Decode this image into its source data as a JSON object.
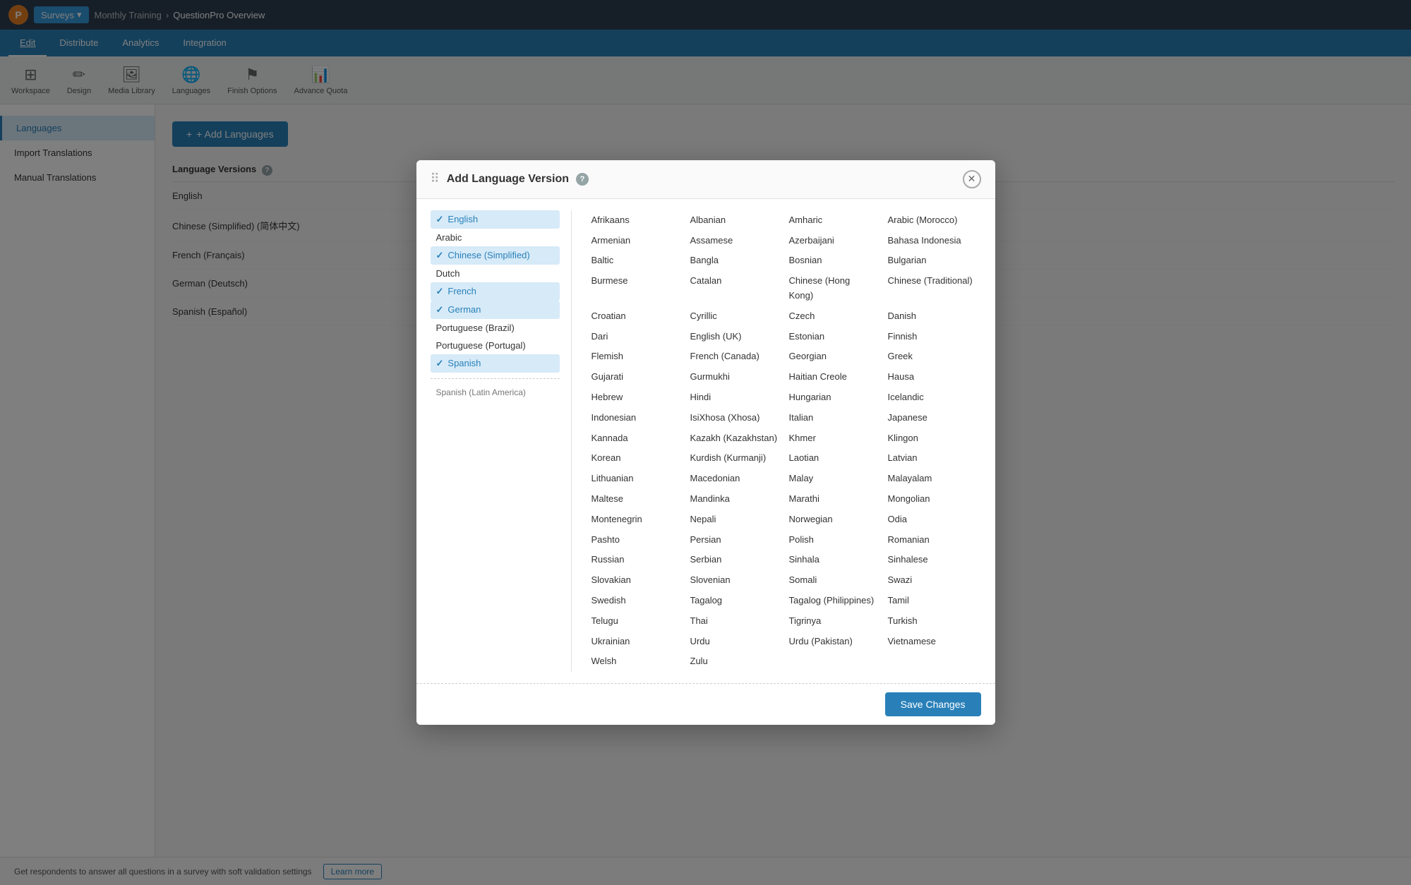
{
  "topnav": {
    "logo": "P",
    "surveys_label": "Surveys",
    "breadcrumb_training": "Monthly Training",
    "breadcrumb_sep": "›",
    "breadcrumb_current": "QuestionPro Overview"
  },
  "secondnav": {
    "tabs": [
      "Edit",
      "Distribute",
      "Analytics",
      "Integration"
    ]
  },
  "toolbar": {
    "items": [
      {
        "icon": "⊞",
        "label": "Workspace"
      },
      {
        "icon": "✏",
        "label": "Design"
      },
      {
        "icon": "🖼",
        "label": "Media Library"
      },
      {
        "icon": "🌐",
        "label": "Languages"
      },
      {
        "icon": "⚑",
        "label": "Finish Options"
      },
      {
        "icon": "📊",
        "label": "Advance Quota"
      }
    ]
  },
  "sidebar": {
    "items": [
      "Languages",
      "Import Translations",
      "Manual Translations"
    ]
  },
  "content": {
    "add_languages_label": "+ Add Languages",
    "lang_versions_header": "Language Versions",
    "help_icon": "?",
    "language_versions": [
      "English",
      "Chinese (Simplified) (简体中文)",
      "French (Français)",
      "German (Deutsch)",
      "Spanish (Español)"
    ]
  },
  "modal": {
    "title": "Add Language Version",
    "help": "?",
    "drag_handle": "⠿",
    "close": "✕",
    "checked_languages": [
      {
        "label": "English",
        "checked": true
      },
      {
        "label": "Arabic",
        "checked": false
      },
      {
        "label": "Chinese (Simplified)",
        "checked": true
      },
      {
        "label": "Dutch",
        "checked": false
      },
      {
        "label": "French",
        "checked": true
      },
      {
        "label": "German",
        "checked": true
      },
      {
        "label": "Portuguese (Brazil)",
        "checked": false
      },
      {
        "label": "Portuguese (Portugal)",
        "checked": false
      },
      {
        "label": "Spanish",
        "checked": true
      }
    ],
    "other_section_label": "Spanish (Latin America)",
    "other_languages": [
      "Afrikaans",
      "Albanian",
      "Amharic",
      "Arabic (Morocco)",
      "Armenian",
      "Assamese",
      "Azerbaijani",
      "Bahasa Indonesia",
      "Baltic",
      "Bangla",
      "Bosnian",
      "Bulgarian",
      "Burmese",
      "Catalan",
      "Chinese (Hong Kong)",
      "Chinese (Traditional)",
      "Croatian",
      "Cyrillic",
      "Czech",
      "Danish",
      "Dari",
      "English (UK)",
      "Estonian",
      "Finnish",
      "Flemish",
      "French (Canada)",
      "Georgian",
      "Greek",
      "Gujarati",
      "Gurmukhi",
      "Haitian Creole",
      "Hausa",
      "Hebrew",
      "Hindi",
      "Hungarian",
      "Icelandic",
      "Indonesian",
      "IsiXhosa (Xhosa)",
      "Italian",
      "Japanese",
      "Kannada",
      "Kazakh (Kazakhstan)",
      "Khmer",
      "Klingon",
      "Korean",
      "Kurdish (Kurmanji)",
      "Laotian",
      "Latvian",
      "Lithuanian",
      "Macedonian",
      "Malay",
      "Malayalam",
      "Maltese",
      "Mandinka",
      "Marathi",
      "Mongolian",
      "Montenegrin",
      "Nepali",
      "Norwegian",
      "Odia",
      "Pashto",
      "Persian",
      "Polish",
      "Romanian",
      "Russian",
      "Serbian",
      "Sinhala",
      "Sinhalese",
      "Slovakian",
      "Slovenian",
      "Somali",
      "Swazi",
      "Swedish",
      "Tagalog",
      "Tagalog (Philippines)",
      "Tamil",
      "Telugu",
      "Thai",
      "Tigrinya",
      "Turkish",
      "Ukrainian",
      "Urdu",
      "Urdu (Pakistan)",
      "Vietnamese",
      "Welsh",
      "Zulu"
    ],
    "save_changes_label": "Save Changes"
  },
  "bottombar": {
    "message": "Get respondents to answer all questions in a survey with soft validation settings",
    "learn_more": "Learn more"
  }
}
